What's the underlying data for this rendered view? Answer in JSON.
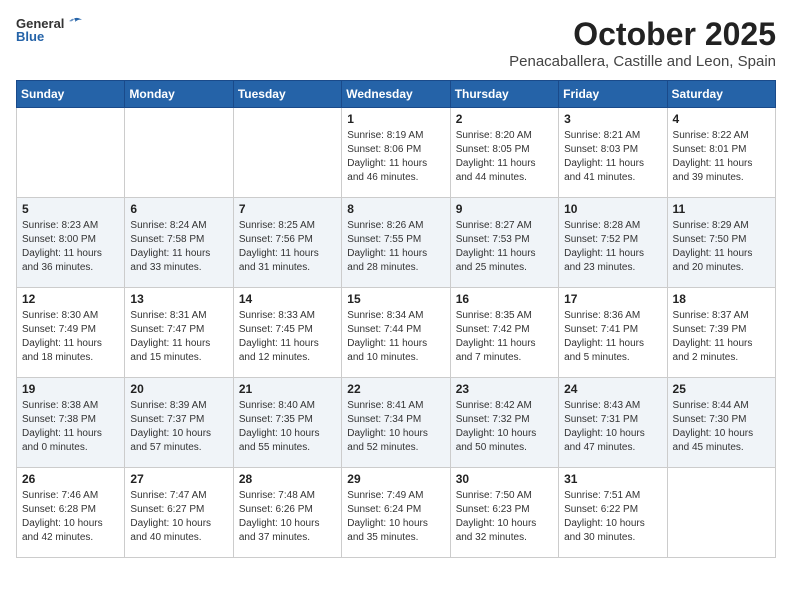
{
  "header": {
    "logo_general": "General",
    "logo_blue": "Blue",
    "title": "October 2025",
    "subtitle": "Penacaballera, Castille and Leon, Spain"
  },
  "weekdays": [
    "Sunday",
    "Monday",
    "Tuesday",
    "Wednesday",
    "Thursday",
    "Friday",
    "Saturday"
  ],
  "weeks": [
    [
      {
        "day": "",
        "info": ""
      },
      {
        "day": "",
        "info": ""
      },
      {
        "day": "",
        "info": ""
      },
      {
        "day": "1",
        "info": "Sunrise: 8:19 AM\nSunset: 8:06 PM\nDaylight: 11 hours\nand 46 minutes."
      },
      {
        "day": "2",
        "info": "Sunrise: 8:20 AM\nSunset: 8:05 PM\nDaylight: 11 hours\nand 44 minutes."
      },
      {
        "day": "3",
        "info": "Sunrise: 8:21 AM\nSunset: 8:03 PM\nDaylight: 11 hours\nand 41 minutes."
      },
      {
        "day": "4",
        "info": "Sunrise: 8:22 AM\nSunset: 8:01 PM\nDaylight: 11 hours\nand 39 minutes."
      }
    ],
    [
      {
        "day": "5",
        "info": "Sunrise: 8:23 AM\nSunset: 8:00 PM\nDaylight: 11 hours\nand 36 minutes."
      },
      {
        "day": "6",
        "info": "Sunrise: 8:24 AM\nSunset: 7:58 PM\nDaylight: 11 hours\nand 33 minutes."
      },
      {
        "day": "7",
        "info": "Sunrise: 8:25 AM\nSunset: 7:56 PM\nDaylight: 11 hours\nand 31 minutes."
      },
      {
        "day": "8",
        "info": "Sunrise: 8:26 AM\nSunset: 7:55 PM\nDaylight: 11 hours\nand 28 minutes."
      },
      {
        "day": "9",
        "info": "Sunrise: 8:27 AM\nSunset: 7:53 PM\nDaylight: 11 hours\nand 25 minutes."
      },
      {
        "day": "10",
        "info": "Sunrise: 8:28 AM\nSunset: 7:52 PM\nDaylight: 11 hours\nand 23 minutes."
      },
      {
        "day": "11",
        "info": "Sunrise: 8:29 AM\nSunset: 7:50 PM\nDaylight: 11 hours\nand 20 minutes."
      }
    ],
    [
      {
        "day": "12",
        "info": "Sunrise: 8:30 AM\nSunset: 7:49 PM\nDaylight: 11 hours\nand 18 minutes."
      },
      {
        "day": "13",
        "info": "Sunrise: 8:31 AM\nSunset: 7:47 PM\nDaylight: 11 hours\nand 15 minutes."
      },
      {
        "day": "14",
        "info": "Sunrise: 8:33 AM\nSunset: 7:45 PM\nDaylight: 11 hours\nand 12 minutes."
      },
      {
        "day": "15",
        "info": "Sunrise: 8:34 AM\nSunset: 7:44 PM\nDaylight: 11 hours\nand 10 minutes."
      },
      {
        "day": "16",
        "info": "Sunrise: 8:35 AM\nSunset: 7:42 PM\nDaylight: 11 hours\nand 7 minutes."
      },
      {
        "day": "17",
        "info": "Sunrise: 8:36 AM\nSunset: 7:41 PM\nDaylight: 11 hours\nand 5 minutes."
      },
      {
        "day": "18",
        "info": "Sunrise: 8:37 AM\nSunset: 7:39 PM\nDaylight: 11 hours\nand 2 minutes."
      }
    ],
    [
      {
        "day": "19",
        "info": "Sunrise: 8:38 AM\nSunset: 7:38 PM\nDaylight: 11 hours\nand 0 minutes."
      },
      {
        "day": "20",
        "info": "Sunrise: 8:39 AM\nSunset: 7:37 PM\nDaylight: 10 hours\nand 57 minutes."
      },
      {
        "day": "21",
        "info": "Sunrise: 8:40 AM\nSunset: 7:35 PM\nDaylight: 10 hours\nand 55 minutes."
      },
      {
        "day": "22",
        "info": "Sunrise: 8:41 AM\nSunset: 7:34 PM\nDaylight: 10 hours\nand 52 minutes."
      },
      {
        "day": "23",
        "info": "Sunrise: 8:42 AM\nSunset: 7:32 PM\nDaylight: 10 hours\nand 50 minutes."
      },
      {
        "day": "24",
        "info": "Sunrise: 8:43 AM\nSunset: 7:31 PM\nDaylight: 10 hours\nand 47 minutes."
      },
      {
        "day": "25",
        "info": "Sunrise: 8:44 AM\nSunset: 7:30 PM\nDaylight: 10 hours\nand 45 minutes."
      }
    ],
    [
      {
        "day": "26",
        "info": "Sunrise: 7:46 AM\nSunset: 6:28 PM\nDaylight: 10 hours\nand 42 minutes."
      },
      {
        "day": "27",
        "info": "Sunrise: 7:47 AM\nSunset: 6:27 PM\nDaylight: 10 hours\nand 40 minutes."
      },
      {
        "day": "28",
        "info": "Sunrise: 7:48 AM\nSunset: 6:26 PM\nDaylight: 10 hours\nand 37 minutes."
      },
      {
        "day": "29",
        "info": "Sunrise: 7:49 AM\nSunset: 6:24 PM\nDaylight: 10 hours\nand 35 minutes."
      },
      {
        "day": "30",
        "info": "Sunrise: 7:50 AM\nSunset: 6:23 PM\nDaylight: 10 hours\nand 32 minutes."
      },
      {
        "day": "31",
        "info": "Sunrise: 7:51 AM\nSunset: 6:22 PM\nDaylight: 10 hours\nand 30 minutes."
      },
      {
        "day": "",
        "info": ""
      }
    ]
  ]
}
